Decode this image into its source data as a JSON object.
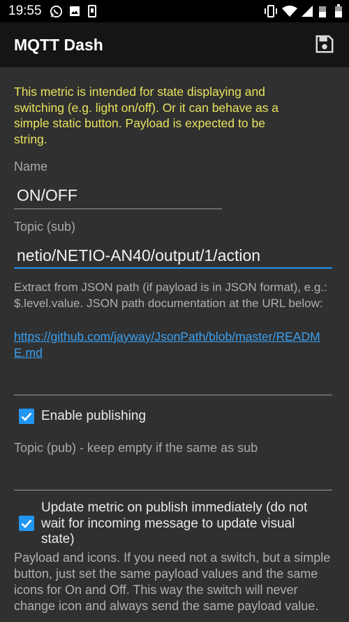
{
  "status_bar": {
    "time": "19:55",
    "left_icons": [
      "whatsapp-icon",
      "image-icon",
      "sim-icon"
    ],
    "right_icons": [
      "vibrate-icon",
      "wifi-icon",
      "signal-icon",
      "battery-icon"
    ]
  },
  "app_bar": {
    "title": "MQTT Dash",
    "action_icon": "save-icon"
  },
  "form": {
    "intro": "This metric is intended for state displaying and switching (e.g. light on/off). Or it can behave as a simple static button. Payload is expected to be string.",
    "name": {
      "label": "Name",
      "value": "ON/OFF"
    },
    "topic_sub": {
      "label": "Topic (sub)",
      "value": "netio/NETIO-AN40/output/1/action"
    },
    "json_help": "Extract from JSON path (if payload is in JSON format), e.g.: $.level.value. JSON path documentation at the URL below:",
    "json_link": "https://github.com/jayway/JsonPath/blob/master/README.md",
    "json_path": {
      "value": ""
    },
    "enable_publishing": {
      "label": "Enable publishing",
      "checked": true
    },
    "topic_pub": {
      "label": "Topic (pub) - keep empty if the same as sub",
      "value": ""
    },
    "update_immediately": {
      "label": "Update metric on publish immediately (do not wait for incoming message to update visual state)",
      "checked": true
    },
    "payload_help": "Payload and icons. If you need not a switch, but a simple button, just set the same payload values and the same icons for On and Off. This way the switch will never change icon and always send the same payload value."
  },
  "colors": {
    "background": "#303030",
    "status_bar": "#000000",
    "app_bar": "#151515",
    "intro_text": "#e8e35f",
    "accent": "#2196f3",
    "link": "#3aa0f0"
  }
}
